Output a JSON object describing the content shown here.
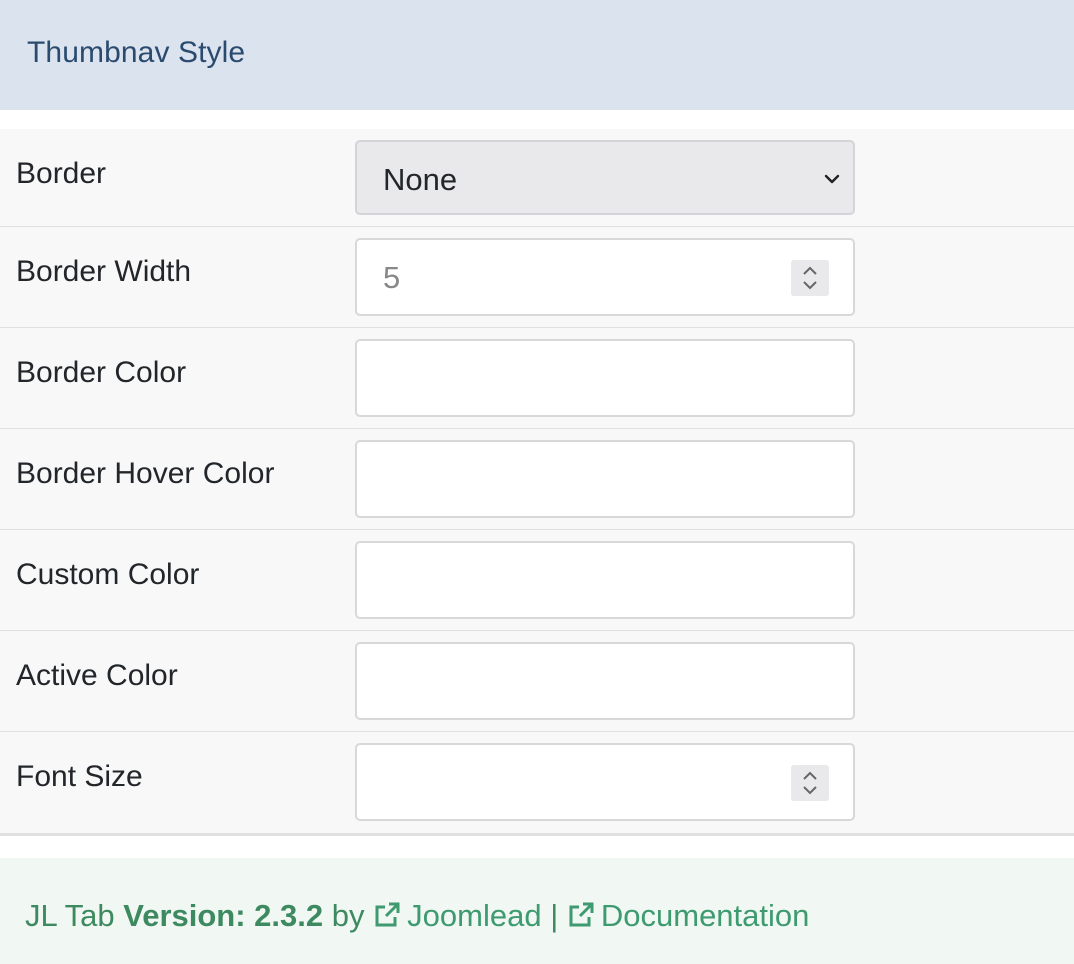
{
  "header": {
    "title": "Thumbnav Style"
  },
  "fields": [
    {
      "label": "Border",
      "type": "select",
      "value": "None"
    },
    {
      "label": "Border Width",
      "type": "number",
      "value": "5"
    },
    {
      "label": "Border Color",
      "type": "text",
      "value": ""
    },
    {
      "label": "Border Hover Color",
      "type": "text",
      "value": ""
    },
    {
      "label": "Custom Color",
      "type": "text",
      "value": ""
    },
    {
      "label": "Active Color",
      "type": "text",
      "value": ""
    },
    {
      "label": "Font Size",
      "type": "number",
      "value": ""
    }
  ],
  "footer": {
    "product": "JL Tab",
    "version_label": "Version: 2.3.2",
    "by": "by",
    "author_link": "Joomlead",
    "separator": "|",
    "docs_link": "Documentation"
  },
  "icons": {
    "select_arrow": "chevron-down-icon",
    "spinner": "spinner-arrows-icon",
    "external_link": "external-link-icon"
  },
  "colors": {
    "header_bg": "#dbe3ef",
    "header_text": "#2a4a6e",
    "footer_bg": "#f1f7f3",
    "footer_text": "#3e8a60"
  }
}
